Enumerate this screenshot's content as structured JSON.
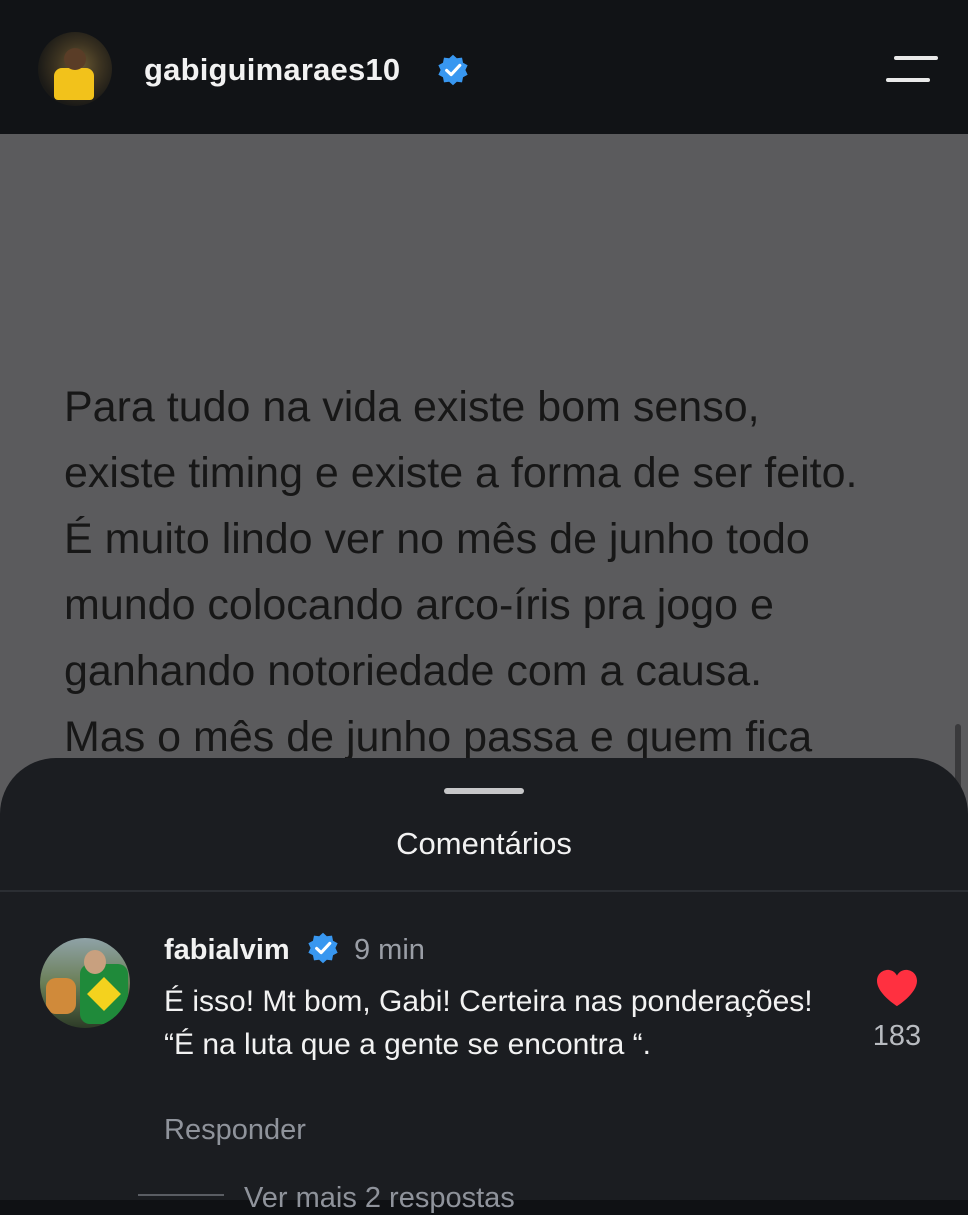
{
  "header": {
    "username": "gabiguimaraes10",
    "verified": true
  },
  "post": {
    "text": "Para tudo na vida existe bom senso,\nexiste timing e existe a forma de ser feito.\nÉ muito lindo ver no mês de junho todo\nmundo colocando arco-íris pra jogo e\nganhando notoriedade com a causa.\nMas o mês de junho passa e quem fica"
  },
  "comments_sheet": {
    "title": "Comentários",
    "comment": {
      "username": "fabialvim",
      "verified": true,
      "time": "9 min",
      "text": "É isso! Mt bom, Gabi! Certeira nas ponderações! “É na luta que a gente se encontra “.",
      "like_count": "183",
      "reply_label": "Responder",
      "more_replies_label": "Ver mais 2 respostas"
    }
  },
  "colors": {
    "verified_blue": "#3897f0",
    "heart_red": "#ff3040"
  },
  "icons": [
    "avatar",
    "verified-badge-icon",
    "menu-icon",
    "heart-icon"
  ]
}
